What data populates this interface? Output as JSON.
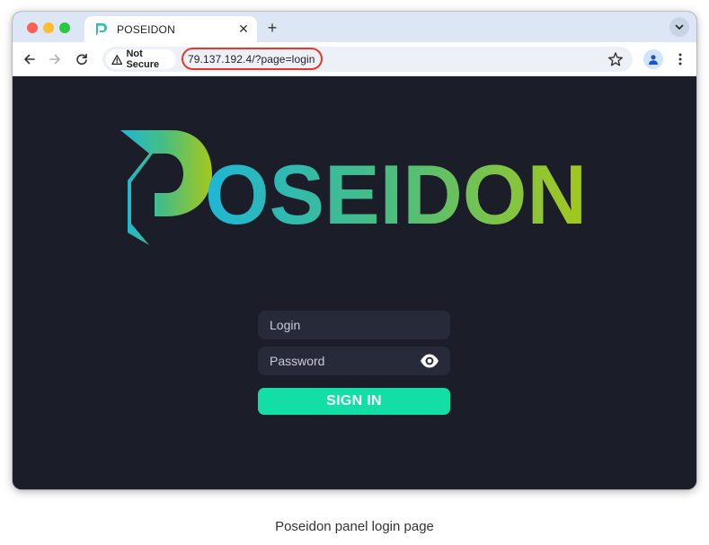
{
  "browser": {
    "tab_title": "POSEIDON",
    "security_label": "Not Secure",
    "url": "79.137.192.4/?page=login"
  },
  "page": {
    "logo_text": "POSEIDON",
    "login_placeholder": "Login",
    "password_placeholder": "Password",
    "signin_label": "SIGN IN"
  },
  "caption": "Poseidon panel login page",
  "colors": {
    "page_background": "#1b1d28",
    "input_background": "#272a38",
    "signin_button": "#13dea6",
    "logo_gradient_start": "#1fb6d6",
    "logo_gradient_end": "#a6c81a",
    "url_highlight": "#e03a2b"
  },
  "icons": [
    "poseidon-favicon",
    "close-icon",
    "plus-icon",
    "chevron-down-icon",
    "back-arrow-icon",
    "forward-arrow-icon",
    "reload-icon",
    "warning-icon",
    "star-icon",
    "profile-icon",
    "kebab-menu-icon",
    "eye-icon"
  ]
}
